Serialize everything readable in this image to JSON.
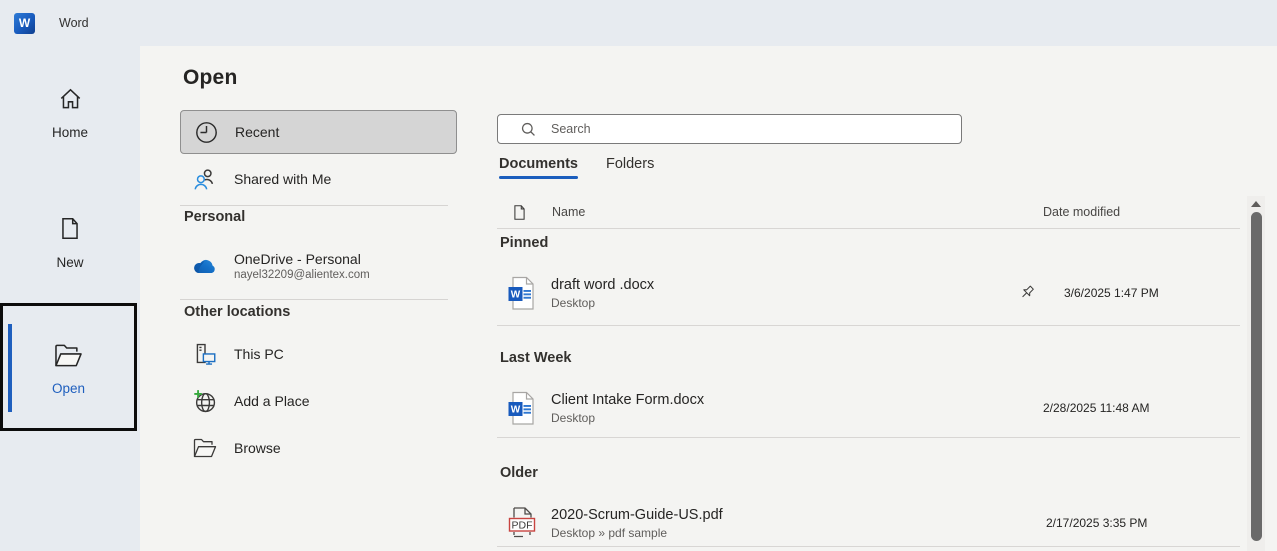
{
  "app": {
    "title": "Word",
    "logo_letter": "W",
    "accent_color": "#185abd",
    "selected_text_color": "#1f5fbe"
  },
  "page": {
    "title": "Open"
  },
  "rail": {
    "items": [
      {
        "label": "Home",
        "selected": false
      },
      {
        "label": "New",
        "selected": false
      },
      {
        "label": "Open",
        "selected": true
      }
    ]
  },
  "open_nav": {
    "items": [
      {
        "label": "Recent",
        "selected": true
      },
      {
        "label": "Shared with Me",
        "selected": false
      }
    ],
    "sections": [
      {
        "header": "Personal",
        "items": [
          {
            "label": "OneDrive - Personal",
            "sub": "nayel32209@alientex.com"
          }
        ]
      },
      {
        "header": "Other locations",
        "items": [
          {
            "label": "This PC"
          },
          {
            "label": "Add a Place"
          },
          {
            "label": "Browse"
          }
        ]
      }
    ]
  },
  "search": {
    "placeholder": "Search"
  },
  "tabs": [
    {
      "label": "Documents",
      "selected": true
    },
    {
      "label": "Folders",
      "selected": false
    }
  ],
  "file_list": {
    "columns": {
      "name": "Name",
      "date": "Date modified"
    },
    "groups": [
      {
        "header": "Pinned",
        "files": [
          {
            "name": "draft word .docx",
            "location": "Desktop",
            "date": "3/6/2025 1:47 PM",
            "type": "word",
            "pinned": true
          }
        ]
      },
      {
        "header": "Last Week",
        "files": [
          {
            "name": "Client Intake Form.docx",
            "location": "Desktop",
            "date": "2/28/2025 11:48 AM",
            "type": "word",
            "pinned": false
          }
        ]
      },
      {
        "header": "Older",
        "files": [
          {
            "name": "2020-Scrum-Guide-US.pdf",
            "location": "Desktop » pdf sample",
            "date": "2/17/2025 3:35 PM",
            "type": "pdf",
            "pinned": false
          }
        ]
      }
    ]
  },
  "pdf_badge_text": "PDF"
}
